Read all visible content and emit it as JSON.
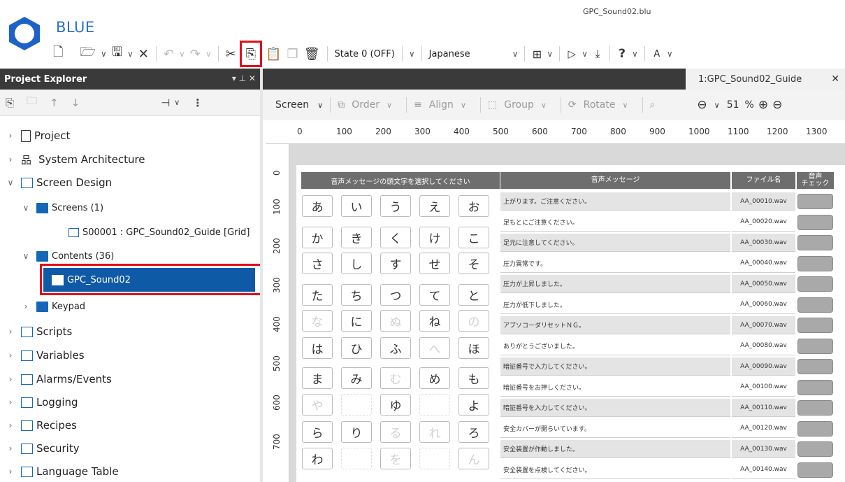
{
  "app": {
    "brand": "BLUE",
    "doc_title": "GPC_Sound02.blu"
  },
  "toolbar": {
    "state_select": "State 0 (OFF)",
    "language_select": "Japanese"
  },
  "project_explorer": {
    "title": "Project Explorer",
    "header_controls": "▾ ⊥ ✕",
    "tree": [
      {
        "label": "Project"
      },
      {
        "label": "System Architecture"
      },
      {
        "label": "Screen Design"
      },
      {
        "label": "Screens (1)"
      },
      {
        "label": "S00001 : GPC_Sound02_Guide [Grid]"
      },
      {
        "label": "Contents (36)"
      },
      {
        "label": "GPC_Sound02"
      },
      {
        "label": "Keypad"
      },
      {
        "label": "Scripts"
      },
      {
        "label": "Variables"
      },
      {
        "label": "Alarms/Events"
      },
      {
        "label": "Logging"
      },
      {
        "label": "Recipes"
      },
      {
        "label": "Security"
      },
      {
        "label": "Language Table"
      }
    ]
  },
  "editor": {
    "tab_label": "1:GPC_Sound02_Guide",
    "tools": {
      "screen": "Screen",
      "order": "Order",
      "align": "Align",
      "group": "Group",
      "rotate": "Rotate",
      "zoom": "51",
      "zoom_unit": "%"
    },
    "ruler_h": [
      "0",
      "100",
      "200",
      "300",
      "400",
      "500",
      "600",
      "700",
      "800",
      "900",
      "1000",
      "1100",
      "1200",
      "1300"
    ],
    "ruler_v": [
      "0",
      "100",
      "200",
      "300",
      "400",
      "500",
      "600",
      "700"
    ]
  },
  "kana_panel": {
    "header": "音声メッセージの頭文字を選択してください",
    "rows": [
      [
        "あ",
        "い",
        "う",
        "え",
        "お"
      ],
      [
        "か",
        "き",
        "く",
        "け",
        "こ"
      ],
      [
        "さ",
        "し",
        "す",
        "せ",
        "そ"
      ],
      [
        "た",
        "ち",
        "つ",
        "て",
        "と"
      ],
      [
        "な",
        "に",
        "ぬ",
        "ね",
        "の"
      ],
      [
        "は",
        "ひ",
        "ふ",
        "へ",
        "ほ"
      ],
      [
        "ま",
        "み",
        "む",
        "め",
        "も"
      ],
      [
        "や",
        "",
        "ゆ",
        "",
        "よ"
      ],
      [
        "ら",
        "り",
        "る",
        "れ",
        "ろ"
      ],
      [
        "わ",
        "",
        "を",
        "",
        "ん"
      ]
    ]
  },
  "message_table": {
    "headers": {
      "message": "音声メッセージ",
      "file": "ファイル名",
      "check": "音声\nチェック"
    },
    "rows": [
      {
        "message": "上がります。ご注意ください。",
        "file": "AA_00010.wav"
      },
      {
        "message": "足もとにご注意ください。",
        "file": "AA_00020.wav"
      },
      {
        "message": "足元に注意してください。",
        "file": "AA_00030.wav"
      },
      {
        "message": "圧力異常です。",
        "file": "AA_00040.wav"
      },
      {
        "message": "圧力が上昇しました。",
        "file": "AA_00050.wav"
      },
      {
        "message": "圧力が低下しました。",
        "file": "AA_00060.wav"
      },
      {
        "message": "アブソコーダリセットＮＧ。",
        "file": "AA_00070.wav"
      },
      {
        "message": "ありがとうございました。",
        "file": "AA_00080.wav"
      },
      {
        "message": "暗証番号で入力してください。",
        "file": "AA_00090.wav"
      },
      {
        "message": "暗証番号をお押しください。",
        "file": "AA_00100.wav"
      },
      {
        "message": "暗証番号を入力してください。",
        "file": "AA_00110.wav"
      },
      {
        "message": "安全カバーが開らいています。",
        "file": "AA_00120.wav"
      },
      {
        "message": "安全装置が作動しました。",
        "file": "AA_00130.wav"
      },
      {
        "message": "安全装置を点検してください。",
        "file": "AA_00140.wav"
      }
    ]
  },
  "colors": {
    "accent_blue": "#1566b7",
    "selection": "#0f5aa6",
    "highlight_red": "#e0101a",
    "header_dark": "#3a3a3a"
  }
}
